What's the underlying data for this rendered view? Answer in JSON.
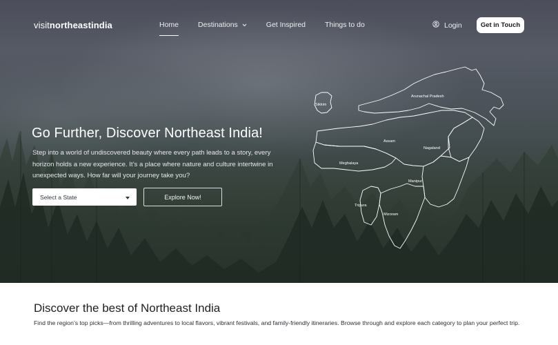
{
  "brand": {
    "logo_part1": "visit",
    "logo_part2": "northeastindia"
  },
  "nav": {
    "items": [
      {
        "label": "Home",
        "active": true
      },
      {
        "label": "Destinations",
        "has_dropdown": true
      },
      {
        "label": "Get Inspired"
      },
      {
        "label": "Things to do"
      }
    ],
    "login_label": "Login",
    "cta_label": "Get in Touch"
  },
  "hero": {
    "title": "Go Further, Discover Northeast India!",
    "description": "Step into a world of undiscovered beauty where every path leads to a story, every horizon holds a new experience. It’s a place where nature and culture intertwine in unexpected ways. How far will your journey take you?",
    "state_select": {
      "selected": "Select a State"
    },
    "explore_label": "Explore Now!"
  },
  "map": {
    "states": [
      "Sikkim",
      "Arunachal Pradesh",
      "Assam",
      "Nagaland",
      "Meghalaya",
      "Manipur",
      "Tripura",
      "Mizoram"
    ]
  },
  "discover": {
    "title": "Discover the best of Northeast India",
    "description": "Find the region’s top picks—from thrilling adventures to local flavors, vibrant festivals, and family-friendly itineraries. Browse through and explore each category to plan your perfect trip."
  },
  "colors": {
    "hero_overlay": "#4b4e5a",
    "forest_dark": "#1f2a24",
    "cta_bg": "#ffffff",
    "text_dark": "#1d1f24"
  },
  "icons": [
    "chevron-down-icon",
    "user-circle-icon",
    "caret-down-icon"
  ]
}
